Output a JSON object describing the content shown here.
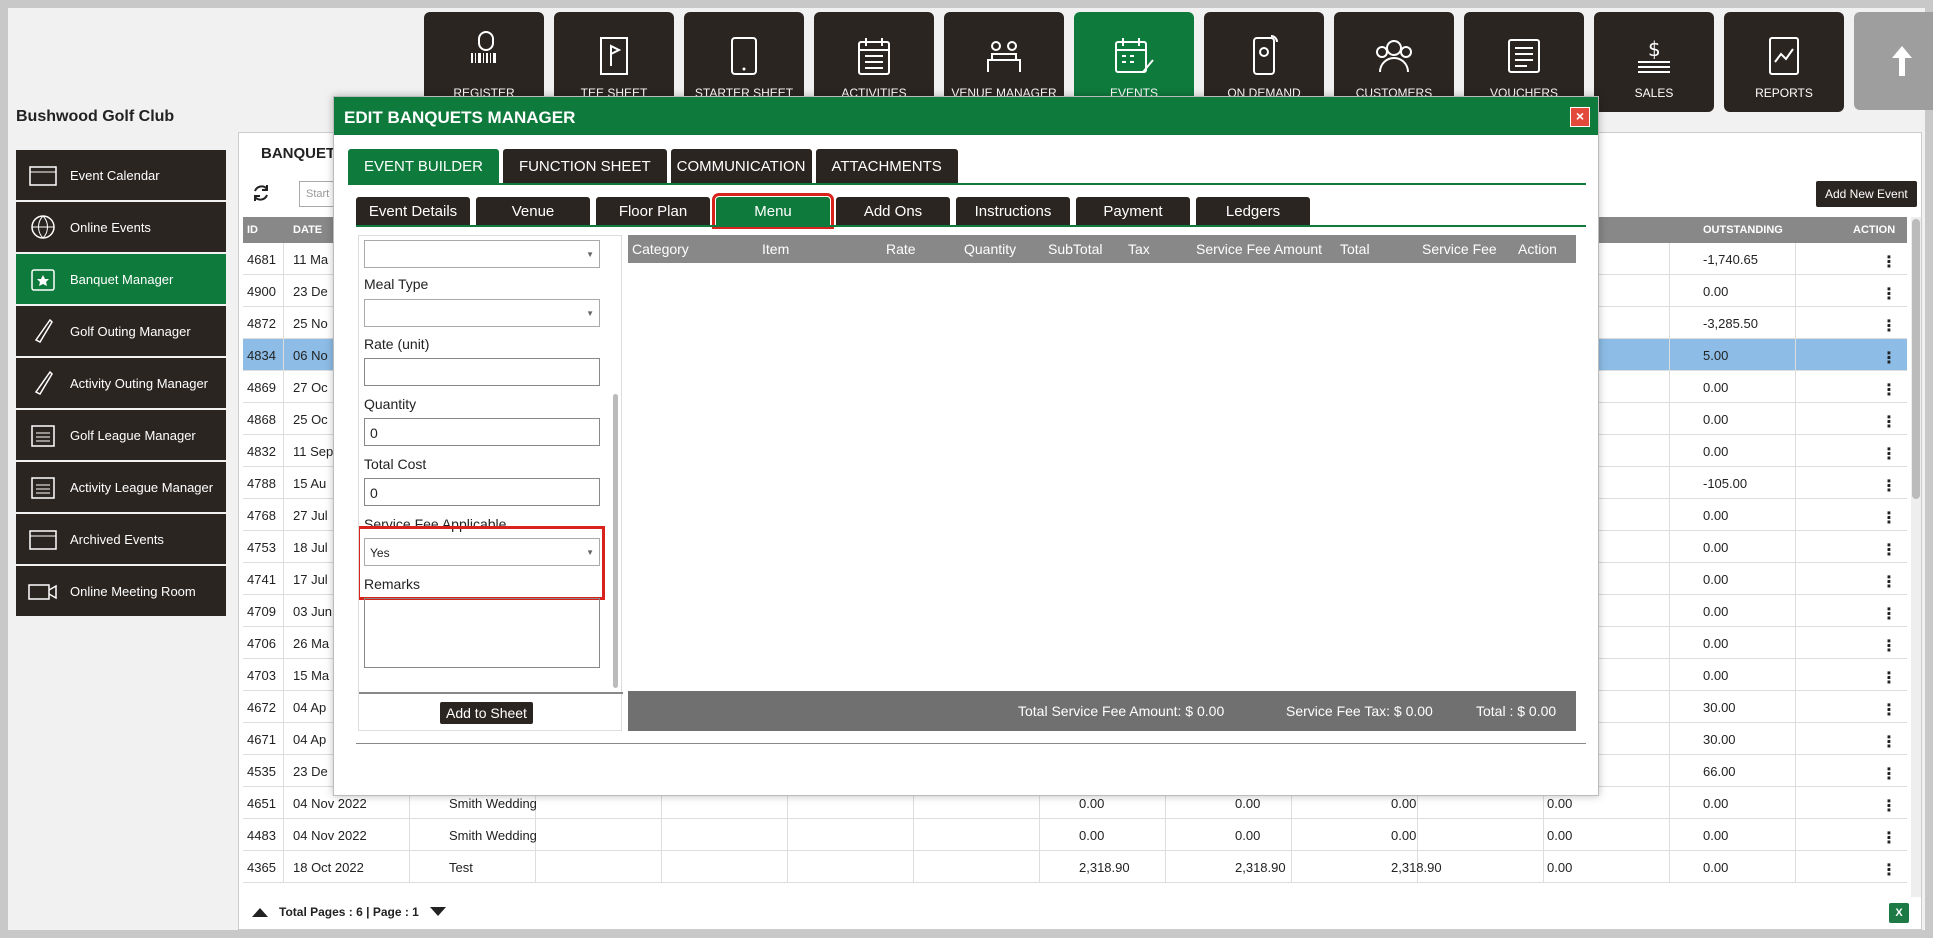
{
  "nav": {
    "items": [
      {
        "label": "REGISTER",
        "icon": "barcode-scanner-icon"
      },
      {
        "label": "TEE SHEET",
        "icon": "tee-sheet-icon"
      },
      {
        "label": "STARTER SHEET",
        "icon": "tablet-icon"
      },
      {
        "label": "ACTIVITIES",
        "icon": "calendar-list-icon"
      },
      {
        "label": "VENUE MANAGER",
        "icon": "venue-icon"
      },
      {
        "label": "EVENTS",
        "icon": "events-calendar-icon"
      },
      {
        "label": "ON DEMAND",
        "icon": "mobile-icon"
      },
      {
        "label": "CUSTOMERS",
        "icon": "people-icon"
      },
      {
        "label": "VOUCHERS",
        "icon": "voucher-icon"
      },
      {
        "label": "SALES",
        "icon": "money-icon"
      },
      {
        "label": "REPORTS",
        "icon": "report-icon"
      }
    ],
    "active": "EVENTS"
  },
  "club_name": "Bushwood Golf Club",
  "sidebar": {
    "items": [
      {
        "label": "Event Calendar"
      },
      {
        "label": "Online Events"
      },
      {
        "label": "Banquet Manager"
      },
      {
        "label": "Golf Outing Manager"
      },
      {
        "label": "Activity Outing Manager"
      },
      {
        "label": "Golf League Manager"
      },
      {
        "label": "Activity League Manager"
      },
      {
        "label": "Archived Events"
      },
      {
        "label": "Online Meeting Room"
      }
    ],
    "active": "Banquet Manager"
  },
  "panel": {
    "title": "BANQUET",
    "search_placeholder": "Start",
    "add_event_label": "Add New Event",
    "columns": [
      "ID",
      "DATE",
      "OUTSTANDING",
      "ACTION"
    ],
    "rows": [
      {
        "id": "4681",
        "date": "11 Ma",
        "name": "",
        "c1": "",
        "c2": "",
        "c3": "",
        "c4": "",
        "outstanding": "-1,740.65"
      },
      {
        "id": "4900",
        "date": "23 De",
        "name": "",
        "c1": "",
        "c2": "",
        "c3": "",
        "c4": "",
        "outstanding": "0.00"
      },
      {
        "id": "4872",
        "date": "25 No",
        "name": "",
        "c1": "",
        "c2": "",
        "c3": "",
        "c4": "",
        "outstanding": "-3,285.50"
      },
      {
        "id": "4834",
        "date": "06 No",
        "name": "",
        "c1": "",
        "c2": "",
        "c3": "",
        "c4": "",
        "outstanding": "5.00"
      },
      {
        "id": "4869",
        "date": "27 Oc",
        "name": "",
        "c1": "",
        "c2": "",
        "c3": "",
        "c4": "",
        "outstanding": "0.00"
      },
      {
        "id": "4868",
        "date": "25 Oc",
        "name": "",
        "c1": "",
        "c2": "",
        "c3": "",
        "c4": "",
        "outstanding": "0.00"
      },
      {
        "id": "4832",
        "date": "11 Sep",
        "name": "",
        "c1": "",
        "c2": "",
        "c3": "",
        "c4": "",
        "outstanding": "0.00"
      },
      {
        "id": "4788",
        "date": "15 Au",
        "name": "",
        "c1": "",
        "c2": "",
        "c3": "",
        "c4": "",
        "outstanding": "-105.00"
      },
      {
        "id": "4768",
        "date": "27 Jul",
        "name": "",
        "c1": "",
        "c2": "",
        "c3": "",
        "c4": "",
        "outstanding": "0.00"
      },
      {
        "id": "4753",
        "date": "18 Jul",
        "name": "",
        "c1": "",
        "c2": "",
        "c3": "",
        "c4": "",
        "outstanding": "0.00"
      },
      {
        "id": "4741",
        "date": "17 Jul",
        "name": "",
        "c1": "",
        "c2": "",
        "c3": "",
        "c4": "",
        "outstanding": "0.00"
      },
      {
        "id": "4709",
        "date": "03 Jun",
        "name": "",
        "c1": "",
        "c2": "",
        "c3": "",
        "c4": "",
        "outstanding": "0.00"
      },
      {
        "id": "4706",
        "date": "26 Ma",
        "name": "",
        "c1": "",
        "c2": "",
        "c3": "",
        "c4": "",
        "outstanding": "0.00"
      },
      {
        "id": "4703",
        "date": "15 Ma",
        "name": "",
        "c1": "",
        "c2": "",
        "c3": "",
        "c4": "",
        "outstanding": "0.00"
      },
      {
        "id": "4672",
        "date": "04 Ap",
        "name": "",
        "c1": "",
        "c2": "",
        "c3": "",
        "c4": "",
        "outstanding": "30.00"
      },
      {
        "id": "4671",
        "date": "04 Ap",
        "name": "",
        "c1": "",
        "c2": "",
        "c3": "",
        "c4": "",
        "outstanding": "30.00"
      },
      {
        "id": "4535",
        "date": "23 De",
        "name": "",
        "c1": "",
        "c2": "",
        "c3": "",
        "c4": "",
        "outstanding": "66.00"
      },
      {
        "id": "4651",
        "date": "04 Nov 2022",
        "name": "Smith Wedding",
        "c1": "0.00",
        "c2": "0.00",
        "c3": "0.00",
        "c4": "0.00",
        "outstanding": "0.00"
      },
      {
        "id": "4483",
        "date": "04 Nov 2022",
        "name": "Smith Wedding",
        "c1": "0.00",
        "c2": "0.00",
        "c3": "0.00",
        "c4": "0.00",
        "outstanding": "0.00"
      },
      {
        "id": "4365",
        "date": "18 Oct 2022",
        "name": "Test",
        "c1": "2,318.90",
        "c2": "2,318.90",
        "c3": "2,318.90",
        "c4": "0.00",
        "outstanding": "0.00"
      }
    ],
    "selected_row": "4834",
    "footer": "Total Pages : 6 | Page : 1"
  },
  "modal": {
    "title": "EDIT BANQUETS MANAGER",
    "close_label": "×",
    "main_tabs": [
      "EVENT BUILDER",
      "FUNCTION SHEET",
      "COMMUNICATION",
      "ATTACHMENTS"
    ],
    "active_main_tab": "EVENT BUILDER",
    "sub_tabs": [
      "Event Details",
      "Venue",
      "Floor Plan",
      "Menu",
      "Add Ons",
      "Instructions",
      "Payment",
      "Ledgers"
    ],
    "active_sub_tab": "Menu",
    "form": {
      "top_select_value": "",
      "meal_type_label": "Meal Type",
      "meal_type_value": "",
      "rate_label": "Rate (unit)",
      "rate_value": "",
      "quantity_label": "Quantity",
      "quantity_value": "0",
      "total_cost_label": "Total Cost",
      "total_cost_value": "0",
      "service_fee_label": "Service Fee Applicable",
      "service_fee_value": "Yes",
      "remarks_label": "Remarks",
      "add_to_sheet_label": "Add to Sheet"
    },
    "table": {
      "columns": [
        "Category",
        "Item",
        "Rate",
        "Quantity",
        "SubTotal",
        "Tax",
        "Service Fee Amount",
        "Total",
        "Service Fee",
        "Action"
      ],
      "total_service_fee_label": "Total Service Fee Amount: $ 0.00",
      "service_fee_tax_label": "Service Fee Tax: $ 0.00",
      "total_label": "Total :  $ 0.00"
    }
  },
  "colors": {
    "accent_green": "#0e7a3c",
    "dark": "#2b2522",
    "highlight_red": "#d9221c",
    "selected_row": "#8dbde6"
  }
}
